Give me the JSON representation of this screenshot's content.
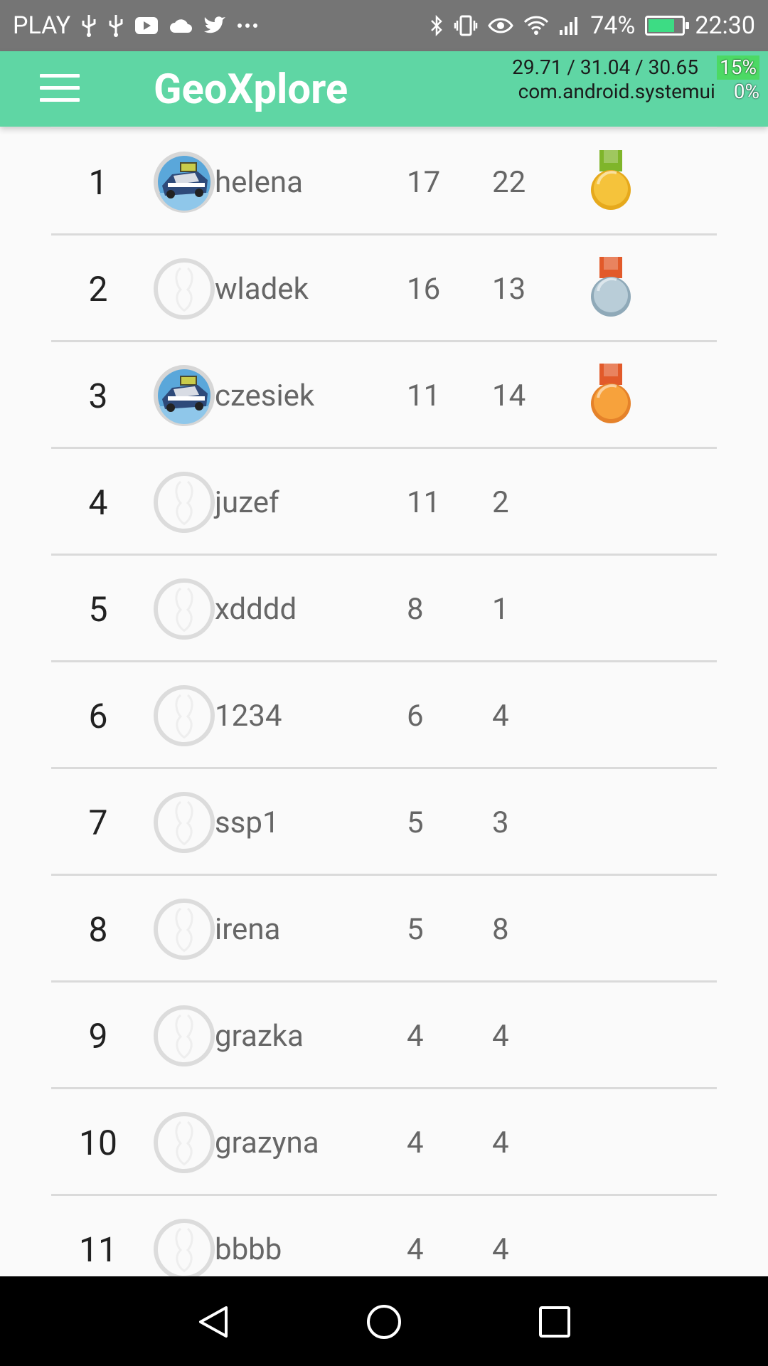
{
  "status_bar": {
    "carrier": "PLAY",
    "battery": "74%",
    "time": "22:30",
    "icons_left": [
      "usb-icon",
      "usb-icon",
      "youtube-icon",
      "cloud-icon",
      "twitter-icon",
      "more-icon"
    ],
    "icons_right": [
      "bluetooth-icon",
      "vibrate-icon",
      "eye-icon",
      "wifi-icon",
      "signal-icon",
      "battery-icon"
    ]
  },
  "overlay": {
    "load": "29.71 / 31.04 / 30.65",
    "cpu_pct": "15%",
    "process": "com.android.systemui",
    "proc_pct": "0%"
  },
  "app_bar": {
    "title": "GeoXplore"
  },
  "leaderboard": {
    "rows": [
      {
        "rank": "1",
        "name": "helena",
        "score": "17",
        "count": "22",
        "avatar": "car",
        "medal": "gold"
      },
      {
        "rank": "2",
        "name": "wladek",
        "score": "16",
        "count": "13",
        "avatar": "default",
        "medal": "silver"
      },
      {
        "rank": "3",
        "name": "czesiek",
        "score": "11",
        "count": "14",
        "avatar": "car",
        "medal": "bronze"
      },
      {
        "rank": "4",
        "name": "juzef",
        "score": "11",
        "count": "2",
        "avatar": "default",
        "medal": ""
      },
      {
        "rank": "5",
        "name": "xdddd",
        "score": "8",
        "count": "1",
        "avatar": "default",
        "medal": ""
      },
      {
        "rank": "6",
        "name": "1234",
        "score": "6",
        "count": "4",
        "avatar": "default",
        "medal": ""
      },
      {
        "rank": "7",
        "name": "ssp1",
        "score": "5",
        "count": "3",
        "avatar": "default",
        "medal": ""
      },
      {
        "rank": "8",
        "name": "irena",
        "score": "5",
        "count": "8",
        "avatar": "default",
        "medal": ""
      },
      {
        "rank": "9",
        "name": "grazka",
        "score": "4",
        "count": "4",
        "avatar": "default",
        "medal": ""
      },
      {
        "rank": "10",
        "name": "grazyna",
        "score": "4",
        "count": "4",
        "avatar": "default",
        "medal": ""
      },
      {
        "rank": "11",
        "name": "bbbb",
        "score": "4",
        "count": "4",
        "avatar": "default",
        "medal": ""
      }
    ]
  },
  "colors": {
    "app_bar": "#5fd6a4",
    "gold": "#f5c33b",
    "silver": "#b9cdd8",
    "bronze": "#f7a23c",
    "divider": "#dadada"
  }
}
